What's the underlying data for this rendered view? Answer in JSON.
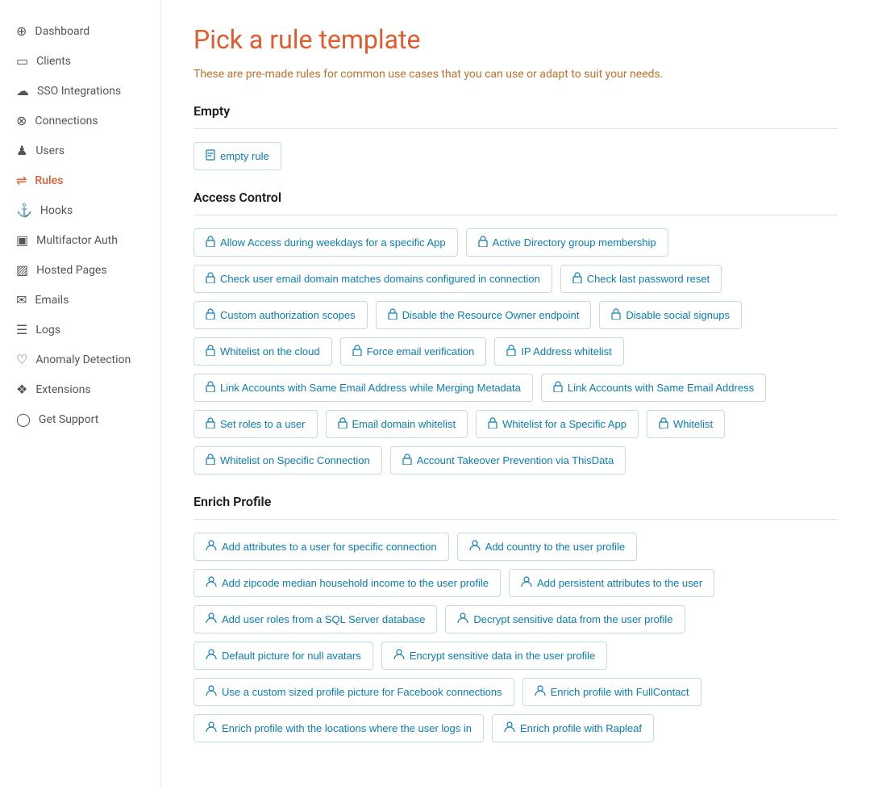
{
  "page": {
    "title": "Pick a rule template",
    "subtitle": "These are pre-made rules for common use cases that you can use or adapt to suit your needs."
  },
  "sidebar": {
    "items": [
      {
        "id": "dashboard",
        "label": "Dashboard",
        "icon": "⊕",
        "active": false
      },
      {
        "id": "clients",
        "label": "Clients",
        "icon": "▭",
        "active": false
      },
      {
        "id": "sso",
        "label": "SSO Integrations",
        "icon": "☁",
        "active": false
      },
      {
        "id": "connections",
        "label": "Connections",
        "icon": "⊗",
        "active": false
      },
      {
        "id": "users",
        "label": "Users",
        "icon": "♟",
        "active": false
      },
      {
        "id": "rules",
        "label": "Rules",
        "icon": "⇌",
        "active": true
      },
      {
        "id": "hooks",
        "label": "Hooks",
        "icon": "⚓",
        "active": false
      },
      {
        "id": "multifactor",
        "label": "Multifactor Auth",
        "icon": "▣",
        "active": false
      },
      {
        "id": "hostedpages",
        "label": "Hosted Pages",
        "icon": "▨",
        "active": false
      },
      {
        "id": "emails",
        "label": "Emails",
        "icon": "✉",
        "active": false
      },
      {
        "id": "logs",
        "label": "Logs",
        "icon": "☰",
        "active": false
      },
      {
        "id": "anomaly",
        "label": "Anomaly Detection",
        "icon": "♡",
        "active": false
      },
      {
        "id": "extensions",
        "label": "Extensions",
        "icon": "❖",
        "active": false
      },
      {
        "id": "support",
        "label": "Get Support",
        "icon": "◯",
        "active": false
      }
    ]
  },
  "sections": [
    {
      "id": "empty",
      "header": "Empty",
      "templates": [
        {
          "id": "empty-rule",
          "label": "empty rule",
          "icon": "file"
        }
      ]
    },
    {
      "id": "access-control",
      "header": "Access Control",
      "templates": [
        {
          "id": "allow-access-weekdays",
          "label": "Allow Access during weekdays for a specific App",
          "icon": "lock"
        },
        {
          "id": "active-directory",
          "label": "Active Directory group membership",
          "icon": "lock"
        },
        {
          "id": "check-email-domain",
          "label": "Check user email domain matches domains configured in connection",
          "icon": "lock"
        },
        {
          "id": "check-password-reset",
          "label": "Check last password reset",
          "icon": "lock"
        },
        {
          "id": "custom-auth-scopes",
          "label": "Custom authorization scopes",
          "icon": "lock"
        },
        {
          "id": "disable-resource-owner",
          "label": "Disable the Resource Owner endpoint",
          "icon": "lock"
        },
        {
          "id": "disable-social-signups",
          "label": "Disable social signups",
          "icon": "lock"
        },
        {
          "id": "whitelist-cloud",
          "label": "Whitelist on the cloud",
          "icon": "lock"
        },
        {
          "id": "force-email-verification",
          "label": "Force email verification",
          "icon": "lock"
        },
        {
          "id": "ip-address-whitelist",
          "label": "IP Address whitelist",
          "icon": "lock"
        },
        {
          "id": "link-accounts-merging",
          "label": "Link Accounts with Same Email Address while Merging Metadata",
          "icon": "lock"
        },
        {
          "id": "link-accounts",
          "label": "Link Accounts with Same Email Address",
          "icon": "lock"
        },
        {
          "id": "set-roles",
          "label": "Set roles to a user",
          "icon": "lock"
        },
        {
          "id": "email-domain-whitelist",
          "label": "Email domain whitelist",
          "icon": "lock"
        },
        {
          "id": "whitelist-specific-app",
          "label": "Whitelist for a Specific App",
          "icon": "lock"
        },
        {
          "id": "whitelist",
          "label": "Whitelist",
          "icon": "lock"
        },
        {
          "id": "whitelist-specific-connection",
          "label": "Whitelist on Specific Connection",
          "icon": "lock"
        },
        {
          "id": "account-takeover",
          "label": "Account Takeover Prevention via ThisData",
          "icon": "lock"
        }
      ]
    },
    {
      "id": "enrich-profile",
      "header": "Enrich Profile",
      "templates": [
        {
          "id": "add-attributes-connection",
          "label": "Add attributes to a user for specific connection",
          "icon": "person"
        },
        {
          "id": "add-country",
          "label": "Add country to the user profile",
          "icon": "person"
        },
        {
          "id": "add-zipcode",
          "label": "Add zipcode median household income to the user profile",
          "icon": "person"
        },
        {
          "id": "add-persistent-attributes",
          "label": "Add persistent attributes to the user",
          "icon": "person"
        },
        {
          "id": "add-user-roles-sql",
          "label": "Add user roles from a SQL Server database",
          "icon": "person"
        },
        {
          "id": "decrypt-sensitive",
          "label": "Decrypt sensitive data from the user profile",
          "icon": "person"
        },
        {
          "id": "default-picture",
          "label": "Default picture for null avatars",
          "icon": "person"
        },
        {
          "id": "encrypt-sensitive",
          "label": "Encrypt sensitive data in the user profile",
          "icon": "person"
        },
        {
          "id": "custom-sized-profile",
          "label": "Use a custom sized profile picture for Facebook connections",
          "icon": "person"
        },
        {
          "id": "enrich-fullcontact",
          "label": "Enrich profile with FullContact",
          "icon": "person"
        },
        {
          "id": "enrich-locations",
          "label": "Enrich profile with the locations where the user logs in",
          "icon": "person"
        },
        {
          "id": "enrich-rapleaf",
          "label": "Enrich profile with Rapleaf",
          "icon": "person"
        }
      ]
    }
  ]
}
